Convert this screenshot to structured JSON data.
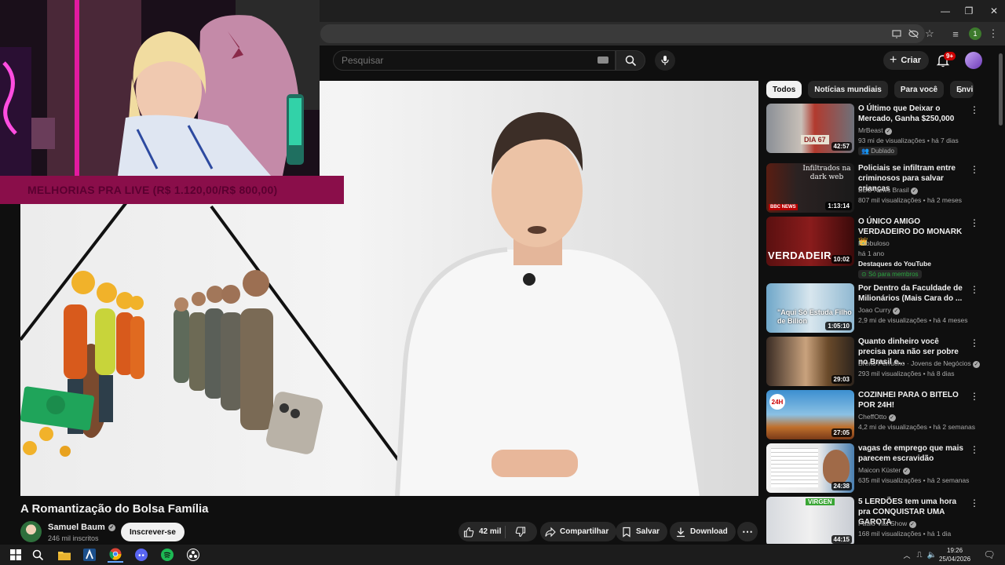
{
  "browser": {
    "window_controls": [
      "—",
      "❐",
      "✕"
    ]
  },
  "header": {
    "search_placeholder": "Pesquisar",
    "create_label": "Criar",
    "notifications_badge": "9+"
  },
  "stream_overlay": {
    "banner_text": "MELHORIAS PRA LIVE (R$ 1.120,00/R$ 800,00)"
  },
  "video": {
    "title": "A Romantização do Bolsa Família",
    "channel": "Samuel Baum",
    "subscribers": "246 mil inscritos",
    "subscribe_label": "Inscrever-se",
    "likes": "42 mil",
    "share_label": "Compartilhar",
    "save_label": "Salvar",
    "download_label": "Download",
    "overlay_text": "",
    "colors": {
      "accent": "#cc0000",
      "banner": "#8a0e4a"
    }
  },
  "chips": [
    "Todos",
    "Notícias mundiais",
    "Para você",
    "Envi"
  ],
  "recommendations": [
    {
      "title": "O Último que Deixar o Mercado, Ganha $250,000",
      "channel": "MrBeast",
      "verified": true,
      "meta": "93 mi de visualizações • há 7 dias",
      "badge": "Dublado",
      "duration": "42:57",
      "thumb_text": "DIA 67"
    },
    {
      "title": "Policiais se infiltram entre criminosos para salvar crianças",
      "channel": "BBC News Brasil",
      "verified": true,
      "meta": "807 mil visualizações • há 2 meses",
      "badge": "",
      "duration": "1:13:14",
      "thumb_text": "Infiltrados na dark web"
    },
    {
      "title": "O ÚNICO AMIGO VERDADEIRO DO MONARK 👑",
      "channel": "Fabbuloso",
      "verified": false,
      "meta": "há 1 ano",
      "badge": "Só para membros",
      "extra": "Destaques do YouTube",
      "duration": "10:02",
      "thumb_text": "VERDADEIR"
    },
    {
      "title": "Por Dentro da Faculdade de Milionários (Mais Cara do ...",
      "channel": "Joao Curry",
      "verified": true,
      "meta": "2,9 mi de visualizações • há 4 meses",
      "badge": "",
      "duration": "1:05:10",
      "thumb_text": "\"Aqui Só Estuda Filho de Bilion"
    },
    {
      "title": "Quanto dinheiro você precisa para não ser pobre no Brasil e...",
      "channel": "Breno Perrucho · Jovens de Negócios",
      "verified": true,
      "meta": "293 mil visualizações • há 8 dias",
      "badge": "",
      "duration": "29:03",
      "thumb_text": ""
    },
    {
      "title": "COZINHEI PARA O BITELO POR 24H!",
      "channel": "CheffOtto",
      "verified": true,
      "meta": "4,2 mi de visualizações • há 2 semanas",
      "badge": "",
      "duration": "27:05",
      "thumb_text": "24H"
    },
    {
      "title": "vagas de emprego que mais parecem escravidão",
      "channel": "Maicon Küster",
      "verified": true,
      "meta": "635 mil visualizações • há 2 semanas",
      "badge": "",
      "duration": "24:38",
      "thumb_text": ""
    },
    {
      "title": "5 LERDÕES tem uma hora pra CONQUISTAR UMA GAROTA",
      "channel": "Paulo Vita Show",
      "verified": true,
      "meta": "168 mil visualizações • há 1 dia",
      "badge": "",
      "duration": "44:15",
      "thumb_text": "VIRGEN"
    }
  ],
  "taskbar": {
    "time": "19:26",
    "date": "25/04/2026"
  }
}
